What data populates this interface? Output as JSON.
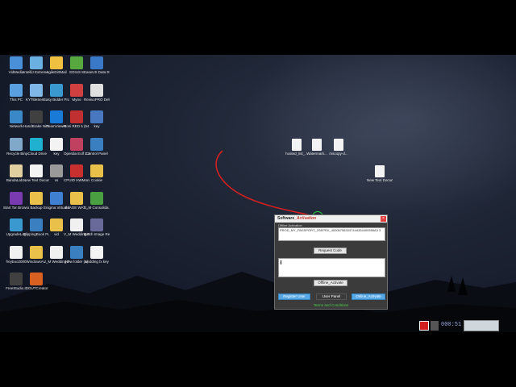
{
  "desktop": {
    "icons": [
      {
        "label": "VidMedia",
        "color": "#4a90d9"
      },
      {
        "label": "IntelliJ Extreme To...",
        "color": "#6ab0e0"
      },
      {
        "label": "AgileDirtMail",
        "color": "#f0c040"
      },
      {
        "label": "EDIUS 8",
        "color": "#58a840"
      },
      {
        "label": "EaseUS Data Recovery ...",
        "color": "#3a78c8"
      },
      {
        "label": "This PC",
        "color": "#5aa0e0"
      },
      {
        "label": "KYTitleSen...",
        "color": "#7fb8e8"
      },
      {
        "label": "Easy Bidder Pro",
        "color": "#3a9ad0"
      },
      {
        "label": "Myno",
        "color": "#d04040"
      },
      {
        "label": "RevivoPRO Deluxe",
        "color": "#e0e0e0"
      },
      {
        "label": "Network",
        "color": "#3a88c8"
      },
      {
        "label": "HandBrake Nitro Pro...",
        "color": "#404040"
      },
      {
        "label": "TeamViewer",
        "color": "#1a7ad8"
      },
      {
        "label": "Roni RED 5 (64 Bit)",
        "color": "#c03030"
      },
      {
        "label": "key",
        "color": "#4878c0"
      },
      {
        "label": "Recycle Bin",
        "color": "#80a8c8"
      },
      {
        "label": "pCloud Drive",
        "color": "#20b0d0"
      },
      {
        "label": "key",
        "color": "#f3f3f3"
      },
      {
        "label": "Operdia Eolf 2.3",
        "color": "#c04060"
      },
      {
        "label": "Control Panel",
        "color": "#3a80c0"
      },
      {
        "label": "BandaLab...",
        "color": "#e0d0a0"
      },
      {
        "label": "New Text Document",
        "color": "#f3f3f3"
      },
      {
        "label": "vs",
        "color": "#9a9a9a"
      },
      {
        "label": "CPUID HWMonitor...",
        "color": "#c83030"
      },
      {
        "label": "Cookie",
        "color": "#e8c04a"
      },
      {
        "label": "Start Tor Browser",
        "color": "#7a3ab0"
      },
      {
        "label": "Backup",
        "color": "#e8c04a"
      },
      {
        "label": "Enigma Virtual Box",
        "color": "#4080d0"
      },
      {
        "label": "IMAGE WAT...",
        "color": "#e8c04a"
      },
      {
        "label": "V_M Consolida...",
        "color": "#4aa040"
      },
      {
        "label": "UpgradeLog",
        "color": "#3a9ad0"
      },
      {
        "label": "FlippingBook Publisher T...",
        "color": "#3a80c0"
      },
      {
        "label": "vid",
        "color": "#e8c04a"
      },
      {
        "label": "V_M Wedding F...",
        "color": "#f0f0f0"
      },
      {
        "label": "Batch Image Resizer",
        "color": "#6a6a9a"
      },
      {
        "label": "freyboo2000",
        "color": "#f0f0f0"
      },
      {
        "label": "WindowsA...",
        "color": "#e8c04a"
      },
      {
        "label": "V_M Wedding Fil...",
        "color": "#f0f0f0"
      },
      {
        "label": "New folder (4)",
        "color": "#3a80c0"
      },
      {
        "label": "wedding fx key",
        "color": "#f3f3f3"
      },
      {
        "label": "FreeStudio...",
        "color": "#404040"
      },
      {
        "label": "IDGUTCreator",
        "color": "#d86020"
      }
    ],
    "floating_files": [
      {
        "label": "hosted_list_..."
      },
      {
        "label": "Watermark..."
      },
      {
        "label": "mscopy-d..."
      },
      {
        "label": "New Text Docume..."
      }
    ]
  },
  "dialog": {
    "title_prefix": "Software",
    "title_accent": "_Activation",
    "close": "×",
    "group_label": "Offline Activation",
    "product_code": "PROD_MY_PASSPORT_2SEPRX_400057583337444334400556A3 3",
    "request_code_btn": "Request Code",
    "offline_activate_btn": "Offline_Activate",
    "register_user_btn": "Register User",
    "user_panel_btn": "User Panel",
    "online_activate_btn": "Online_Activate",
    "terms": "Terms and Conditions"
  },
  "tray": {
    "readout": "000:51"
  }
}
